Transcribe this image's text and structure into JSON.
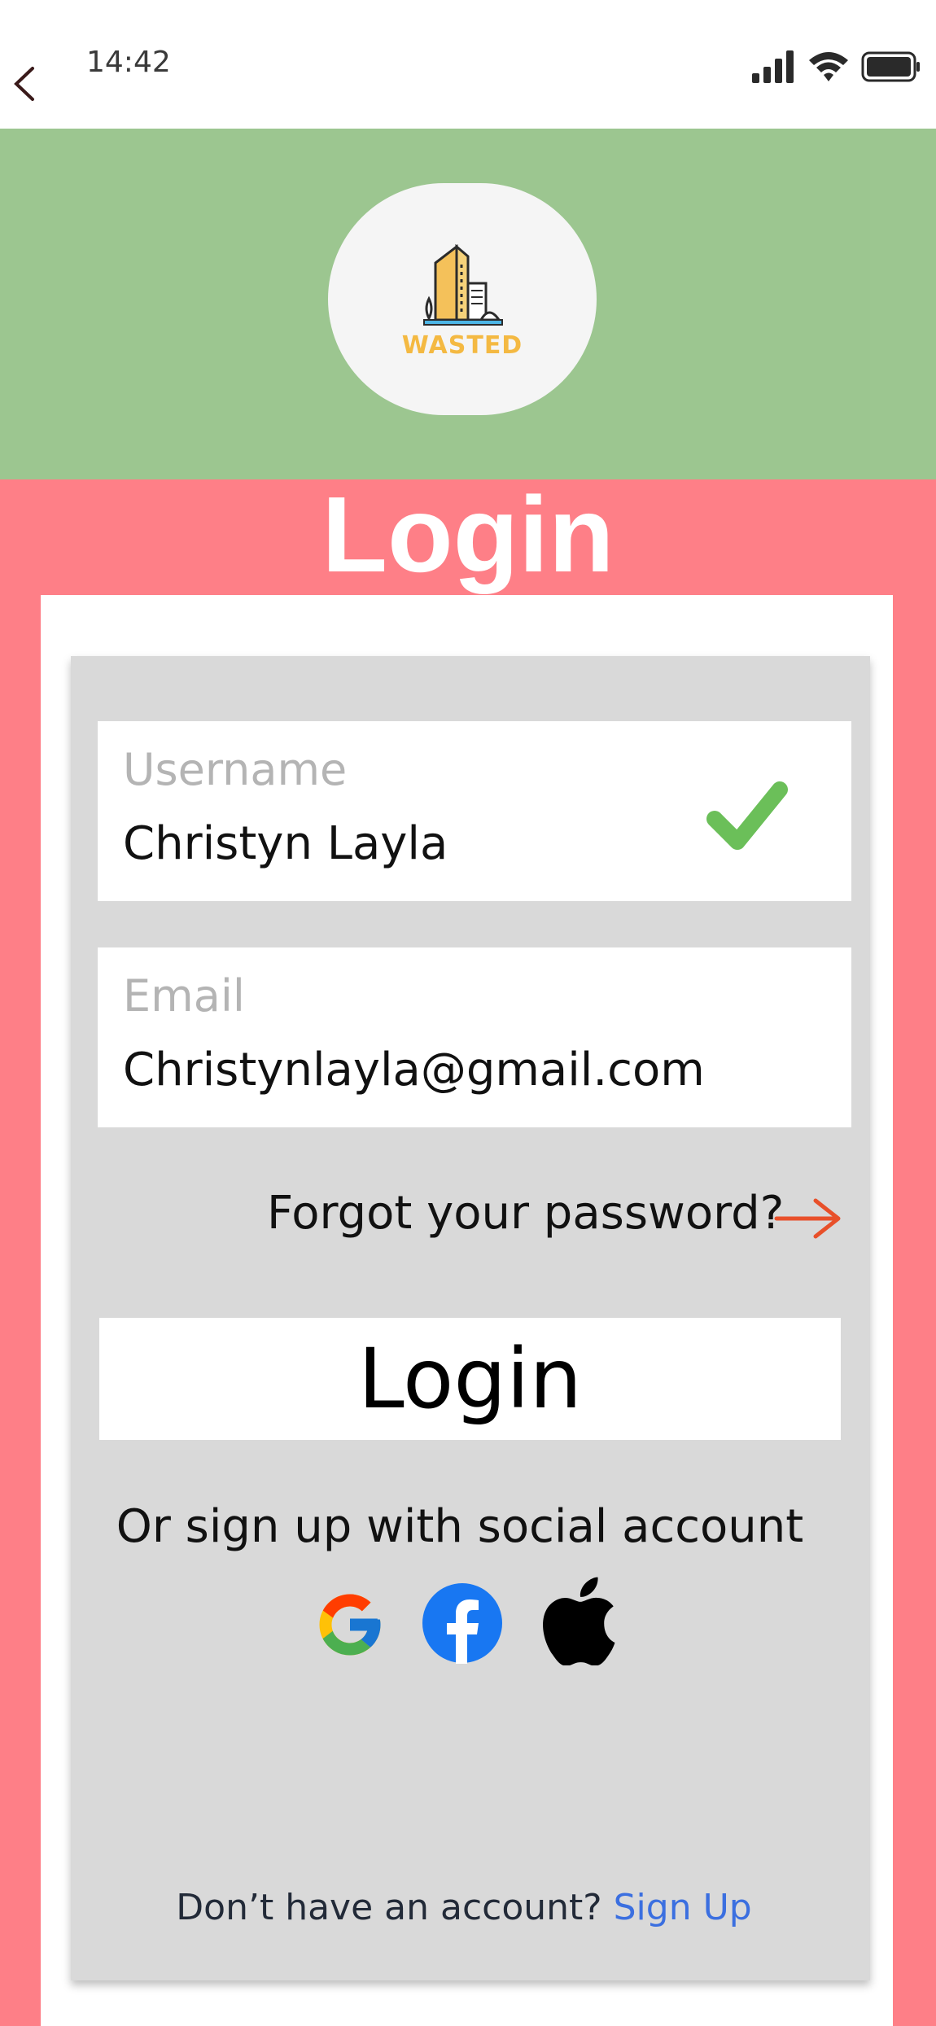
{
  "status_bar": {
    "time": "14:42"
  },
  "brand": {
    "logo_text": "WASTED",
    "accent": "#f4b942"
  },
  "page": {
    "title": "Login"
  },
  "form": {
    "username": {
      "label": "Username",
      "value": "Christyn Layla",
      "valid": true
    },
    "email": {
      "label": "Email",
      "value": "Christynlayla@gmail.com"
    },
    "forgot_password": "Forgot your password?",
    "login_button": "Login",
    "social_prompt": "Or sign up with social account",
    "social_providers": [
      "google",
      "facebook",
      "apple"
    ],
    "no_account_text": "Don’t have an account?",
    "signup_link": "Sign Up"
  },
  "colors": {
    "header": "#9cc690",
    "background": "#fe7f87",
    "card": "#d9d9d9",
    "check": "#6bbf59",
    "arrow": "#e8502a",
    "link": "#3b6fe0"
  }
}
